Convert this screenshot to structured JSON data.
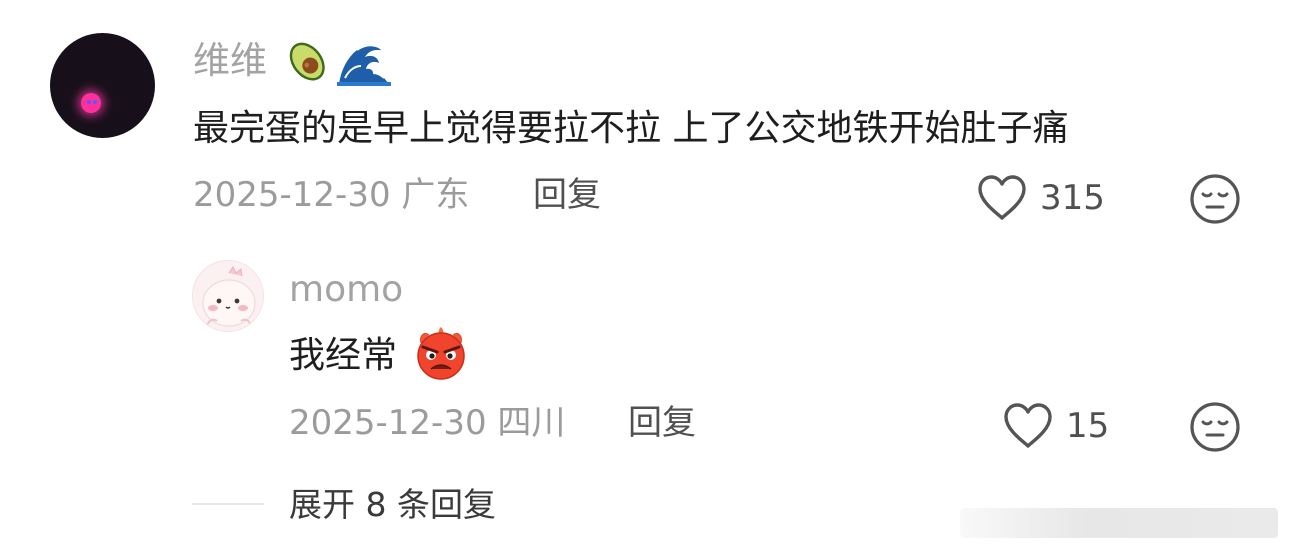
{
  "comment": {
    "username": "维维",
    "username_emojis": [
      "avocado-emoji",
      "wave-emoji"
    ],
    "text": "最完蛋的是早上觉得要拉不拉 上了公交地铁开始肚子痛",
    "date": "2025-12-30",
    "location": "广东",
    "reply_label": "回复",
    "like_count": "315",
    "icons": {
      "like": "heart-outline-icon",
      "dislike": "neutral-face-icon"
    }
  },
  "reply": {
    "username": "momo",
    "text": "我经常",
    "text_emoji": "angry-face-emoji",
    "date": "2025-12-30",
    "location": "四川",
    "reply_label": "回复",
    "like_count": "15",
    "icons": {
      "like": "heart-outline-icon",
      "dislike": "neutral-face-icon"
    }
  },
  "expand": {
    "label": "展开 8 条回复"
  },
  "colors": {
    "username": "#a3a3a3",
    "body_text": "#1e1e1e",
    "meta": "#9b9b9b",
    "action": "#505050",
    "avatar_glow": "#ff2f9c"
  }
}
